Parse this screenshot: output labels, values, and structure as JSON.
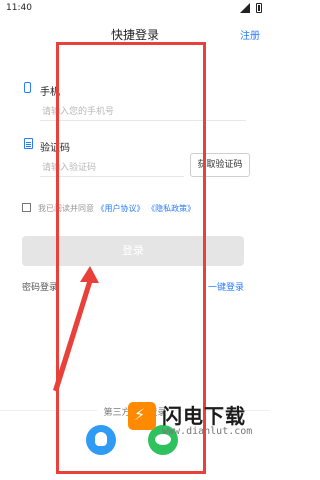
{
  "status_bar": {
    "time": "11:40"
  },
  "header": {
    "title": "快捷登录",
    "register": "注册"
  },
  "phone": {
    "label": "手机",
    "placeholder": "请输入您的手机号"
  },
  "code": {
    "label": "验证码",
    "placeholder": "请输入验证码",
    "button": "获取验证码"
  },
  "agreement": {
    "prefix": "我已阅读并同意",
    "user_agreement": "《用户协议》",
    "privacy_policy": "《隐私政策》"
  },
  "login_button": "登录",
  "password_login": "密码登录",
  "one_click_login": "一键登录",
  "third_party": {
    "title": "第三方账号登录"
  },
  "watermark": {
    "name": "闪电下载",
    "url": "www.dianlut.com"
  },
  "colors": {
    "accent": "#2a7bff",
    "annotation": "#e8413a",
    "qq": "#2f9bf5",
    "wechat": "#2ec25f"
  },
  "icons": [
    "phone-icon",
    "document-icon",
    "qq-icon",
    "wechat-icon",
    "lightning-logo-icon",
    "signal-icon",
    "battery-icon"
  ]
}
